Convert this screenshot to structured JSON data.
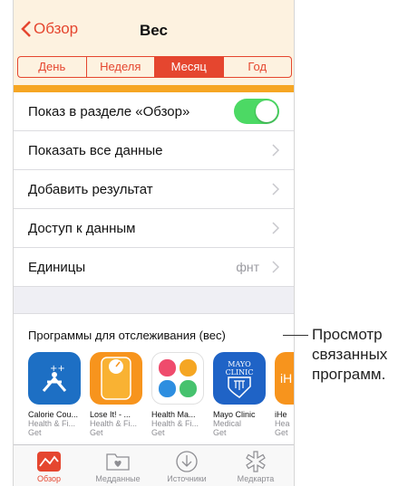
{
  "nav": {
    "back_label": "Обзор",
    "title": "Вес"
  },
  "segments": [
    "День",
    "Неделя",
    "Месяц",
    "Год"
  ],
  "active_segment": "Месяц",
  "rows": {
    "show_overview": "Показ в разделе «Обзор»",
    "show_all": "Показать все данные",
    "add_result": "Добавить результат",
    "data_access": "Доступ к данным",
    "units": "Единицы",
    "units_value": "фнт"
  },
  "apps_section": {
    "heading": "Программы для отслеживания (вес)",
    "apps": [
      {
        "name": "Calorie Cou...",
        "category": "Health & Fi...",
        "action": "Get"
      },
      {
        "name": "Lose It! - ...",
        "category": "Health & Fi...",
        "action": "Get"
      },
      {
        "name": "Health Ma...",
        "category": "Health & Fi...",
        "action": "Get"
      },
      {
        "name": "Mayo Clinic",
        "category": "Medical",
        "action": "Get"
      },
      {
        "name": "iHe",
        "category": "Hea",
        "action": "Get"
      }
    ]
  },
  "tabs": [
    "Обзор",
    "Медданные",
    "Источники",
    "Медкарта"
  ],
  "callout": {
    "line1": "Просмотр",
    "line2": "связанных",
    "line3": "программ."
  },
  "colors": {
    "accent": "#e5462f",
    "nav_bg": "#fdf2e0",
    "toggle_on": "#4cd964",
    "chart_bar": "#f6a623"
  }
}
